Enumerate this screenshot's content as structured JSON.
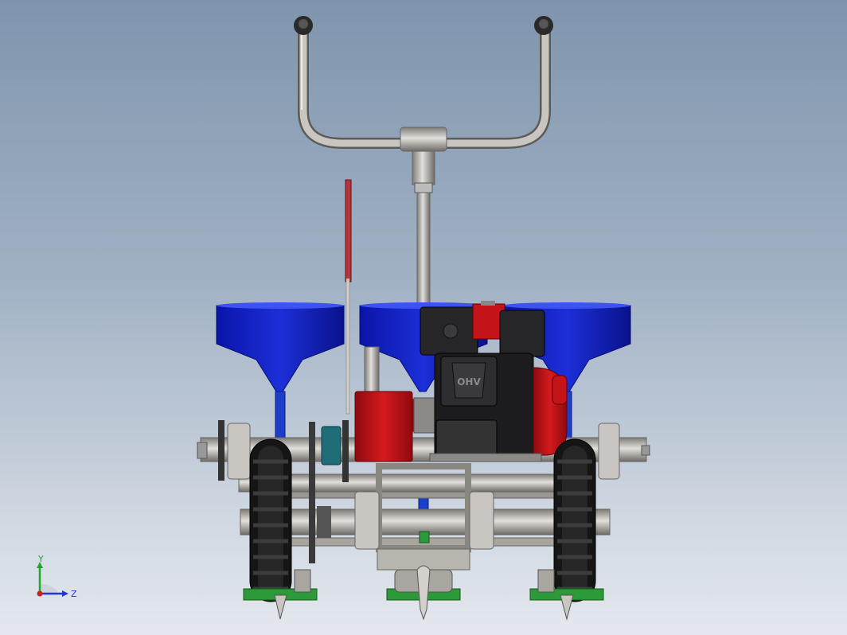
{
  "triad": {
    "y_label": "Y",
    "z_label": "Z"
  },
  "engine_logo": {
    "text": "OHV"
  },
  "colors": {
    "background_top": "#7f95ad",
    "background_bottom": "#e4e8ee",
    "hopper_blue": "#0a14a8",
    "gearbox_red": "#b80f14",
    "engine_black": "#1c1c1e",
    "frame_gray": "#a9a6a0",
    "tire_black": "#151515",
    "furrow_green": "#2c9a38",
    "triad_y": "#1fa82c",
    "triad_z": "#1f36d8",
    "triad_x": "#d21d1d"
  }
}
